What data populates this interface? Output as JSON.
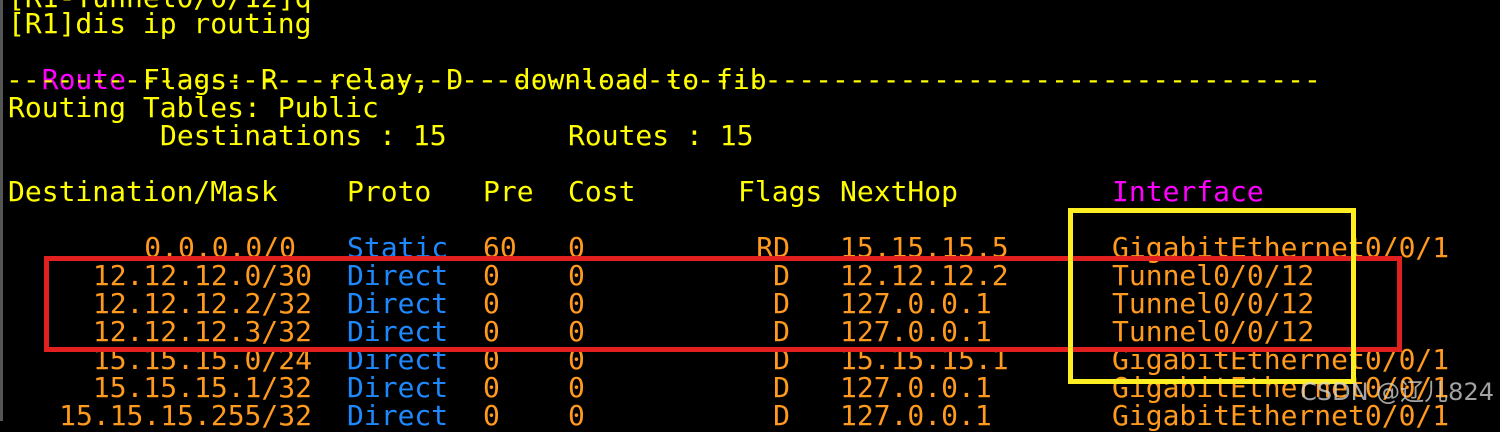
{
  "terminal": {
    "partial_top_line": "[R1-Tunnel0/0/12]q",
    "command_line": "[R1]dis ip routing",
    "route_flags_keyword": "Route",
    "route_flags_text": " Flags: R - relay, D - download to fib",
    "separator": "------------------------------------------------------------------------------",
    "tables_header": "Routing Tables: Public",
    "destinations_label": "Destinations : 15",
    "routes_label": "Routes : 15"
  },
  "table": {
    "headers": {
      "destination_mask": "Destination/Mask",
      "proto": "Proto",
      "pre": "Pre",
      "cost": "Cost",
      "flags": "Flags",
      "nexthop": "NextHop",
      "interface": "Interface"
    },
    "rows": [
      {
        "dest": "0.0.0.0/0",
        "proto": "Static",
        "pre": "60",
        "cost": "0",
        "flags": "RD",
        "nexthop": "15.15.15.5",
        "iface": "GigabitEthernet0/0/1"
      },
      {
        "dest": "12.12.12.0/30",
        "proto": "Direct",
        "pre": "0",
        "cost": "0",
        "flags": "D",
        "nexthop": "12.12.12.2",
        "iface": "Tunnel0/0/12"
      },
      {
        "dest": "12.12.12.2/32",
        "proto": "Direct",
        "pre": "0",
        "cost": "0",
        "flags": "D",
        "nexthop": "127.0.0.1",
        "iface": "Tunnel0/0/12"
      },
      {
        "dest": "12.12.12.3/32",
        "proto": "Direct",
        "pre": "0",
        "cost": "0",
        "flags": "D",
        "nexthop": "127.0.0.1",
        "iface": "Tunnel0/0/12"
      },
      {
        "dest": "15.15.15.0/24",
        "proto": "Direct",
        "pre": "0",
        "cost": "0",
        "flags": "D",
        "nexthop": "15.15.15.1",
        "iface": "GigabitEthernet0/0/1"
      },
      {
        "dest": "15.15.15.1/32",
        "proto": "Direct",
        "pre": "0",
        "cost": "0",
        "flags": "D",
        "nexthop": "127.0.0.1",
        "iface": "GigabitEthernet0/0/1"
      },
      {
        "dest": "15.15.15.255/32",
        "proto": "Direct",
        "pre": "0",
        "cost": "0",
        "flags": "D",
        "nexthop": "127.0.0.1",
        "iface": "GigabitEthernet0/0/1"
      }
    ]
  },
  "watermark": "CSDN @辽儿824",
  "colors": {
    "background": "#000000",
    "text_default": "#ffff00",
    "keyword": "#ff00ff",
    "proto": "#1e88ff",
    "values": "#ff9a1e",
    "highlight_red": "#e32020",
    "highlight_yellow": "#ffee22"
  }
}
